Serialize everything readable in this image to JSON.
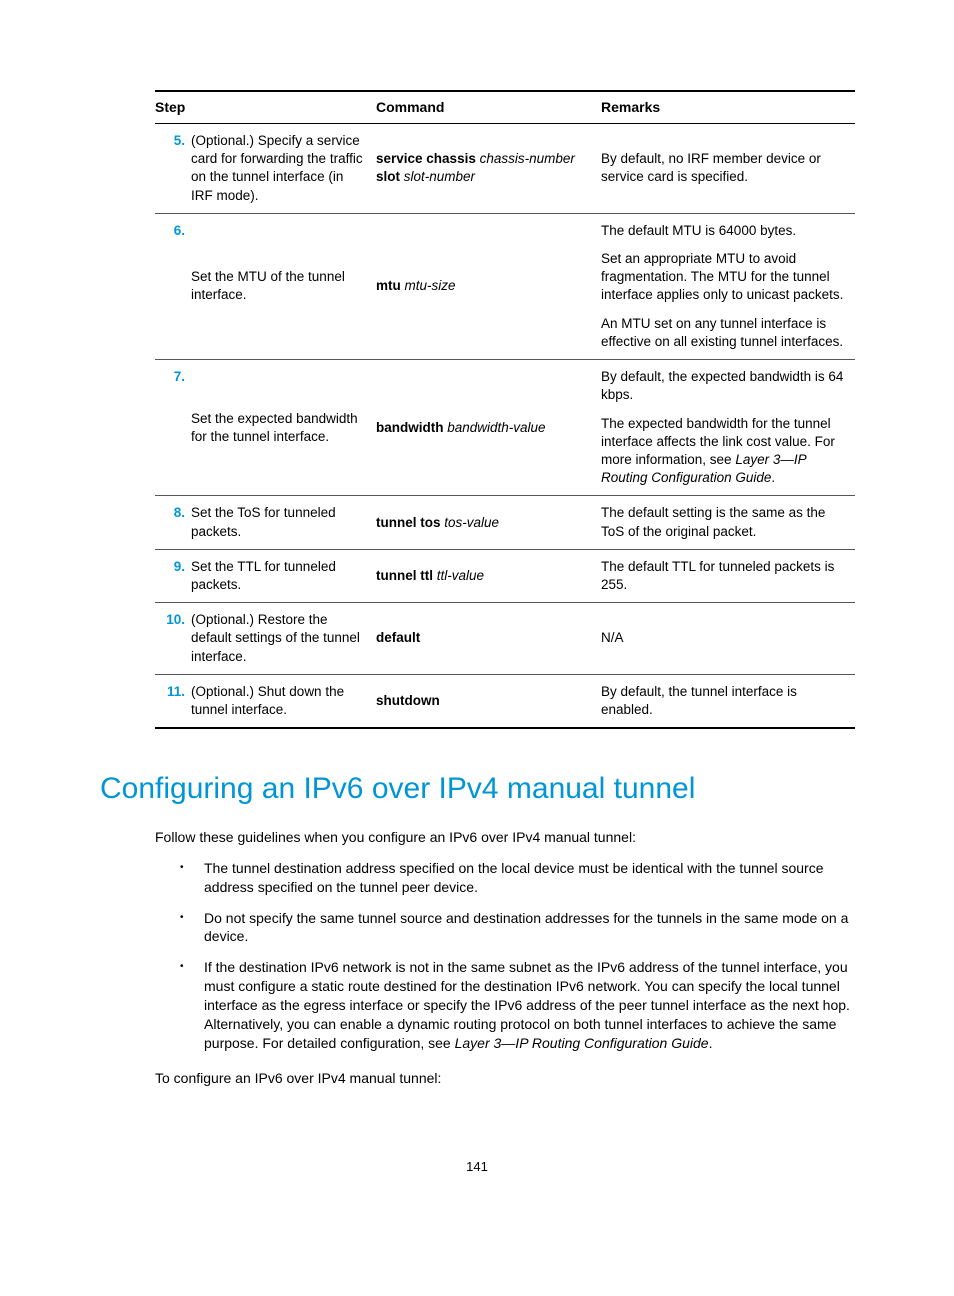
{
  "table": {
    "headers": {
      "step": "Step",
      "command": "Command",
      "remarks": "Remarks"
    },
    "rows": [
      {
        "num": "5.",
        "desc": "(Optional.) Specify a service card for forwarding the traffic on the tunnel interface (in IRF mode).",
        "cmd_b1": "service chassis",
        "cmd_i1": " chassis-number ",
        "cmd_b2": "slot",
        "cmd_i2": " slot-number",
        "remarks": [
          "By default, no IRF member device or service card is specified."
        ]
      },
      {
        "num": "6.",
        "desc": "Set the MTU of the tunnel interface.",
        "cmd_b1": "mtu",
        "cmd_i1": " mtu-size",
        "remarks": [
          "The default MTU is 64000 bytes.",
          "Set an appropriate MTU to avoid fragmentation. The MTU for the tunnel interface applies only to unicast packets.",
          "An MTU set on any tunnel interface is effective on all existing tunnel interfaces."
        ]
      },
      {
        "num": "7.",
        "desc": "Set the expected bandwidth for the tunnel interface.",
        "cmd_b1": "bandwidth",
        "cmd_i1": " bandwidth-value",
        "remarks_p1": "By default, the expected bandwidth is 64 kbps.",
        "remarks_p2_pre": "The expected bandwidth for the tunnel interface affects the link cost value. For more information, see ",
        "remarks_p2_em": "Layer 3—IP Routing Configuration Guide",
        "remarks_p2_post": "."
      },
      {
        "num": "8.",
        "desc": "Set the ToS for tunneled packets.",
        "cmd_b1": "tunnel tos",
        "cmd_i1": " tos-value",
        "remarks": [
          "The default setting is the same as the ToS of the original packet."
        ]
      },
      {
        "num": "9.",
        "desc": "Set the TTL for tunneled packets.",
        "cmd_b1": "tunnel ttl",
        "cmd_i1": " ttl-value",
        "remarks": [
          "The default TTL for tunneled packets is 255."
        ]
      },
      {
        "num": "10.",
        "desc": "(Optional.) Restore the default settings of the tunnel interface.",
        "cmd_b1": "default",
        "remarks": [
          "N/A"
        ]
      },
      {
        "num": "11.",
        "desc": "(Optional.) Shut down the tunnel interface.",
        "cmd_b1": "shutdown",
        "remarks": [
          "By default, the tunnel interface is enabled."
        ]
      }
    ]
  },
  "heading": "Configuring an IPv6 over IPv4 manual tunnel",
  "intro": "Follow these guidelines when you configure an IPv6 over IPv4 manual tunnel:",
  "bullets": {
    "b1": "The tunnel destination address specified on the local device must be identical with the tunnel source address specified on the tunnel peer device.",
    "b2": "Do not specify the same tunnel source and destination addresses for the tunnels in the same mode on a device.",
    "b3_pre": "If the destination IPv6 network is not in the same subnet as the IPv6 address of the tunnel interface, you must configure a static route destined for the destination IPv6 network. You can specify the local tunnel interface as the egress interface or specify the IPv6 address of the peer tunnel interface as the next hop. Alternatively, you can enable a dynamic routing protocol on both tunnel interfaces to achieve the same purpose. For detailed configuration, see ",
    "b3_em": "Layer 3—IP Routing Configuration Guide",
    "b3_post": "."
  },
  "outro": "To configure an IPv6 over IPv4 manual tunnel:",
  "pageNumber": "141"
}
